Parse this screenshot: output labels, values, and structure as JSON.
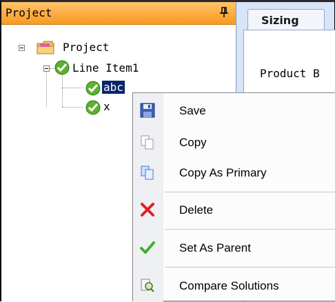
{
  "panel": {
    "title": "Project",
    "pin_icon": "pin-icon"
  },
  "tree": {
    "root_label": "Project",
    "line_item_label": "Line Item1",
    "child_selected_label": "abc",
    "child_second_label": "x"
  },
  "tabs": [
    {
      "label": "Sizing"
    }
  ],
  "content": {
    "label": "Product B"
  },
  "context_menu": {
    "items": [
      {
        "label": "Save",
        "icon": "save-icon"
      },
      {
        "label": "Copy",
        "icon": "copy-icon"
      },
      {
        "label": "Copy As Primary",
        "icon": "copy-as-primary-icon"
      },
      {
        "label": "Delete",
        "icon": "delete-icon"
      },
      {
        "label": "Set As Parent",
        "icon": "checkmark-icon"
      },
      {
        "label": "Compare Solutions",
        "icon": "compare-icon"
      }
    ]
  },
  "colors": {
    "header_orange": "#f79a22",
    "selection": "#0a246a",
    "tab_bg": "#d8e4f8"
  }
}
